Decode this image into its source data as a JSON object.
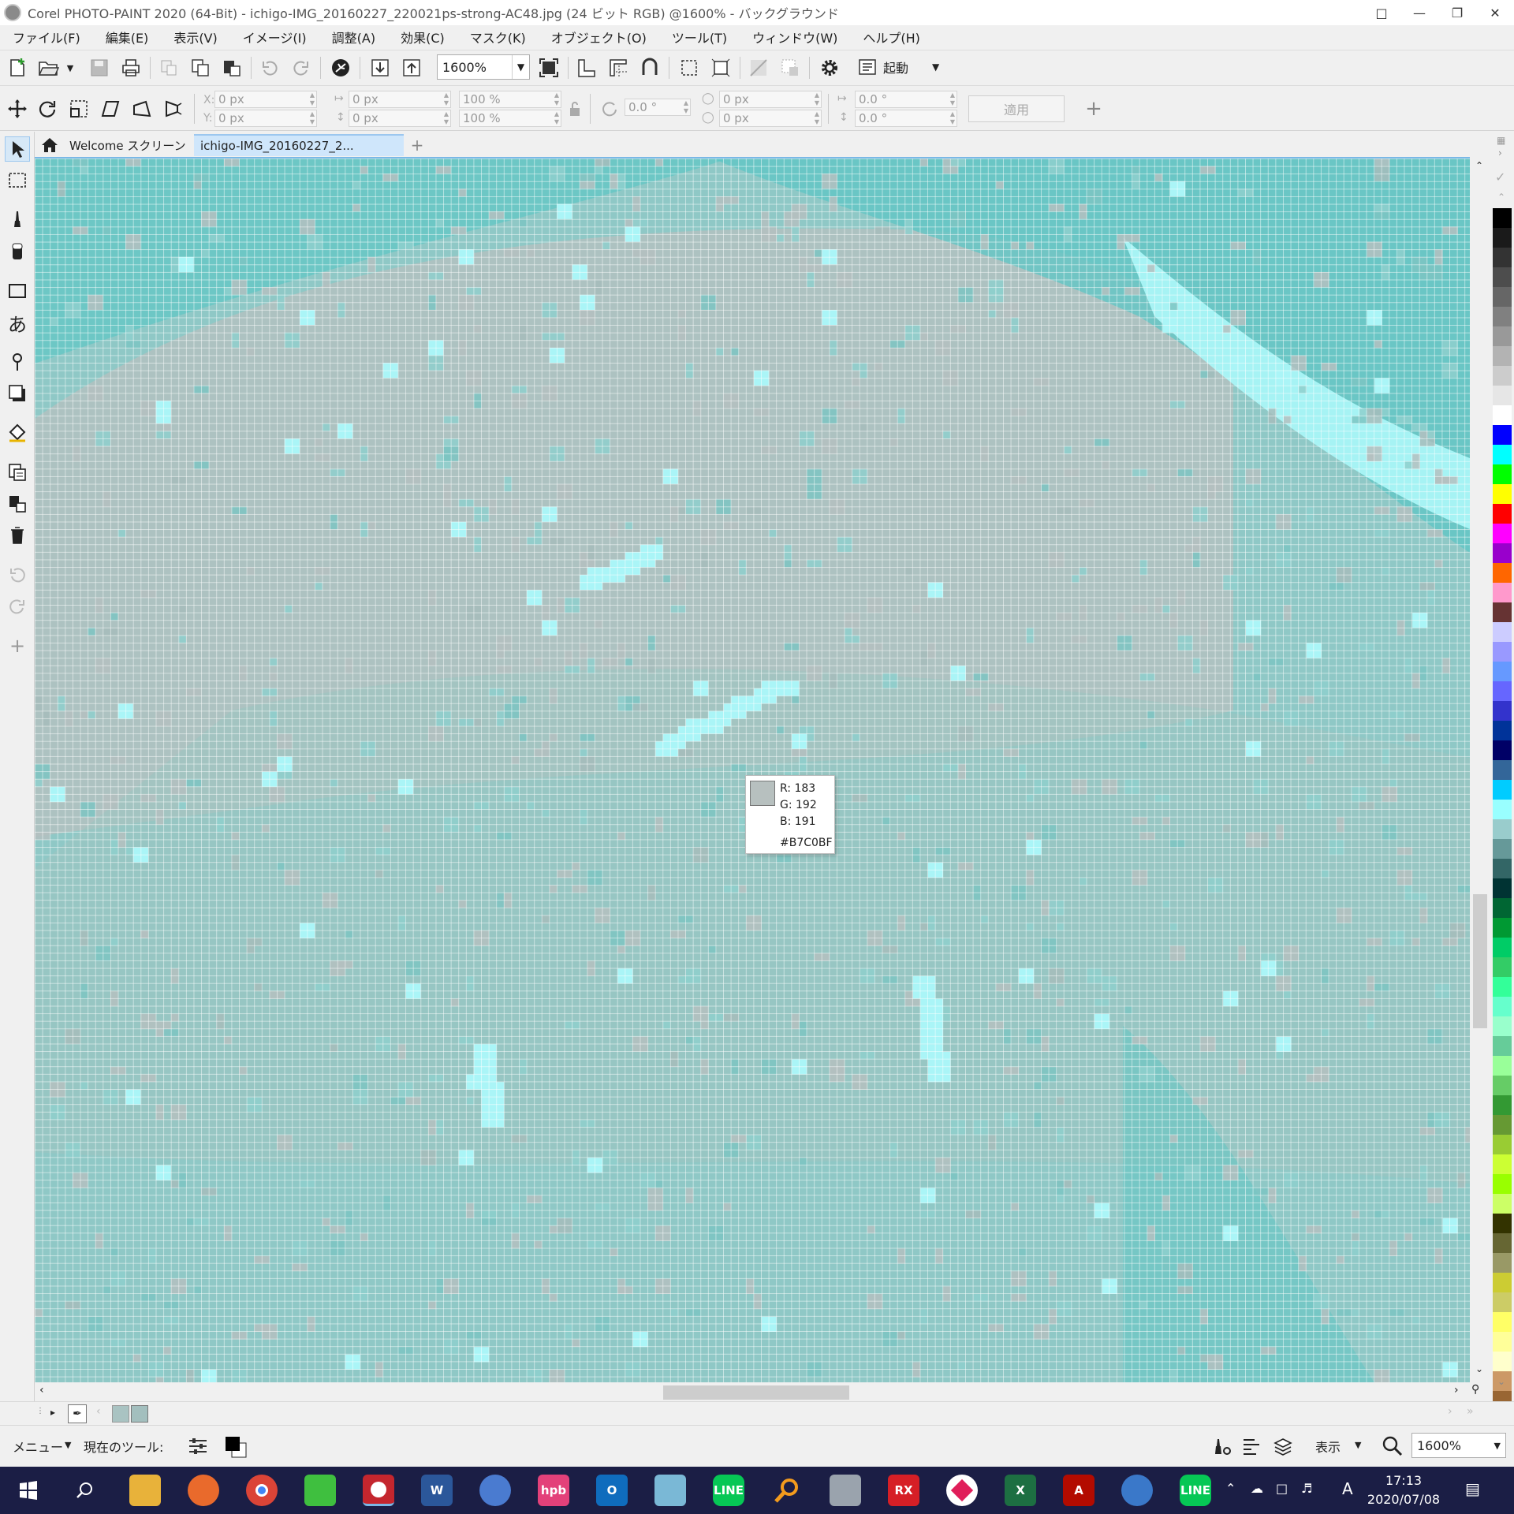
{
  "window": {
    "title": "Corel PHOTO-PAINT 2020 (64-Bit) - ichigo-IMG_20160227_220021ps-strong-AC48.jpg (24 ビット RGB) @1600% - バックグラウンド"
  },
  "menu": [
    "ファイル(F)",
    "編集(E)",
    "表示(V)",
    "イメージ(I)",
    "調整(A)",
    "効果(C)",
    "マスク(K)",
    "オブジェクト(O)",
    "ツール(T)",
    "ウィンドウ(W)",
    "ヘルプ(H)"
  ],
  "toolbar": {
    "zoom": "1600%",
    "launch_label": "起動"
  },
  "property_bar": {
    "x_label": "X:",
    "y_label": "Y:",
    "x": "0 px",
    "y": "0 px",
    "width": "0 px",
    "height": "0 px",
    "scale_w": "100 %",
    "scale_h": "100 %",
    "rotation": "0.0 °",
    "center_x": "0 px",
    "center_y": "0 px",
    "skew_h": "0.0 °",
    "skew_v": "0.0 °",
    "apply_label": "適用"
  },
  "tabs": [
    {
      "label": "Welcome スクリーン"
    },
    {
      "label": "ichigo-IMG_20160227_2..."
    }
  ],
  "tooltip": {
    "r": "R: 183",
    "g": "G: 192",
    "b": "B: 191",
    "hex": "#B7C0BF",
    "swatch_color": "#B7C0BF"
  },
  "statusbar": {
    "menu_label": "メニュー",
    "current_tool_label": "現在のツール:",
    "view_label": "表示",
    "zoom": "1600%"
  },
  "taskbar": {
    "time": "17:13",
    "date": "2020/07/08"
  },
  "palette_colors": [
    "#000000",
    "#1a1a1a",
    "#333333",
    "#4d4d4d",
    "#666666",
    "#808080",
    "#999999",
    "#b3b3b3",
    "#cccccc",
    "#e6e6e6",
    "#ffffff",
    "#0000ff",
    "#00ffff",
    "#00ff00",
    "#ffff00",
    "#ff0000",
    "#ff00ff",
    "#9900cc",
    "#ff6600",
    "#ff99cc",
    "#663333",
    "#ccccff",
    "#9999ff",
    "#6699ff",
    "#6666ff",
    "#3333cc",
    "#003399",
    "#000066",
    "#336699",
    "#00ccff",
    "#99ffff",
    "#99cccc",
    "#669999",
    "#336666",
    "#003333",
    "#006633",
    "#009933",
    "#00cc66",
    "#33cc66",
    "#33ff99",
    "#66ffcc",
    "#99ffcc",
    "#66cc99",
    "#99ff99",
    "#66cc66",
    "#339933",
    "#669933",
    "#99cc33",
    "#ccff33",
    "#99ff00",
    "#ccff66",
    "#333300",
    "#666633",
    "#999966",
    "#cccc33",
    "#cccc66",
    "#ffff66",
    "#ffff99",
    "#ffffcc",
    "#cc9966",
    "#996633"
  ],
  "colors": {
    "canvas_base": "#8FC8C6",
    "canvas_gray": "#B7C0BF",
    "canvas_teal": "#5EC6C4",
    "canvas_cyan": "#AAF5F7",
    "accent_tab": "#CFE6FB",
    "taskbar": "#1B1E45"
  }
}
